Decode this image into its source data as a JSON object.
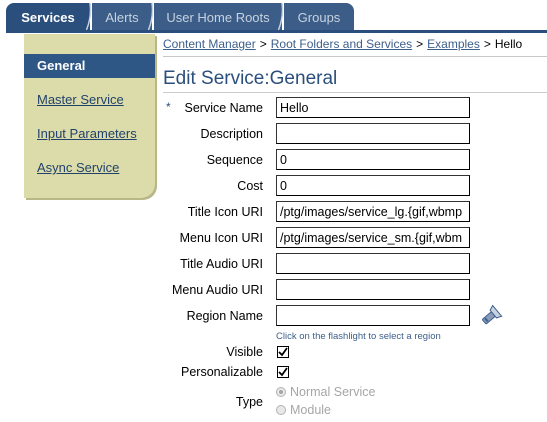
{
  "tabs": [
    {
      "label": "Services",
      "active": true
    },
    {
      "label": "Alerts",
      "active": false
    },
    {
      "label": "User Home Roots",
      "active": false
    },
    {
      "label": "Groups",
      "active": false
    }
  ],
  "sidebar": {
    "items": [
      {
        "label": "General",
        "active": true
      },
      {
        "label": "Master Service",
        "active": false
      },
      {
        "label": "Input Parameters",
        "active": false
      },
      {
        "label": "Async Service",
        "active": false
      }
    ]
  },
  "breadcrumb": [
    {
      "label": "Content Manager",
      "link": true
    },
    {
      "label": "Root Folders and Services",
      "link": true
    },
    {
      "label": "Examples",
      "link": true
    },
    {
      "label": "Hello",
      "link": false
    }
  ],
  "breadcrumb_sep": ">",
  "page_title": "Edit Service:General",
  "required_marker": "*",
  "form": {
    "service_name": {
      "label": "Service Name",
      "value": "Hello"
    },
    "description": {
      "label": "Description",
      "value": ""
    },
    "sequence": {
      "label": "Sequence",
      "value": "0"
    },
    "cost": {
      "label": "Cost",
      "value": "0"
    },
    "title_icon_uri": {
      "label": "Title Icon URI",
      "value": "/ptg/images/service_lg.{gif,wbmp"
    },
    "menu_icon_uri": {
      "label": "Menu Icon URI",
      "value": "/ptg/images/service_sm.{gif,wbm"
    },
    "title_audio_uri": {
      "label": "Title Audio URI",
      "value": ""
    },
    "menu_audio_uri": {
      "label": "Menu Audio URI",
      "value": ""
    },
    "region_name": {
      "label": "Region Name",
      "value": ""
    },
    "region_hint": "Click on the flashlight to select a region",
    "visible": {
      "label": "Visible",
      "checked": true
    },
    "personalizable": {
      "label": "Personalizable",
      "checked": true
    },
    "type": {
      "label": "Type",
      "options": [
        {
          "label": "Normal Service",
          "selected": true
        },
        {
          "label": "Module",
          "selected": false
        }
      ]
    }
  },
  "colors": {
    "tab_active": "#2b4f7c",
    "tab_inactive": "#3b5d88",
    "sidebar_bg": "#dcdcaa",
    "sidebar_active": "#2e5786",
    "link": "#3d5f8c"
  }
}
